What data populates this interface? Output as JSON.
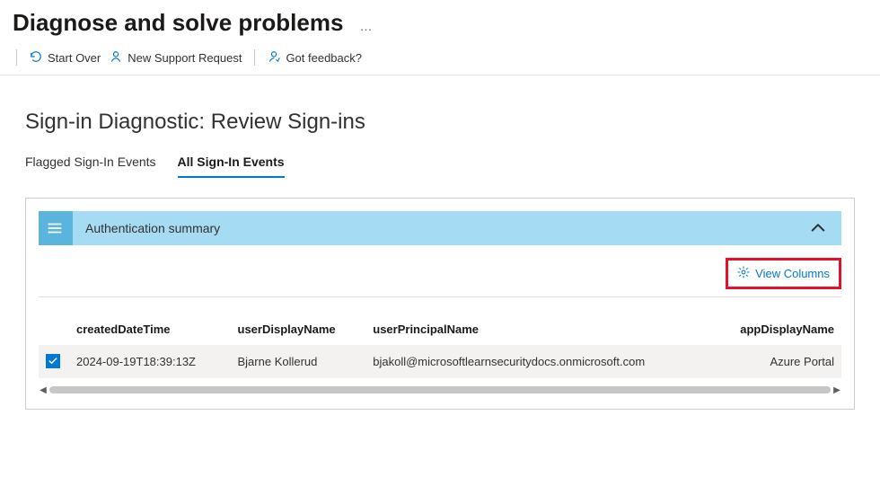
{
  "header": {
    "title": "Diagnose and solve problems",
    "more": "…"
  },
  "toolbar": {
    "startOver": "Start Over",
    "newSupportRequest": "New Support Request",
    "gotFeedback": "Got feedback?"
  },
  "subtitle": "Sign-in Diagnostic: Review Sign-ins",
  "tabs": {
    "flagged": "Flagged Sign-In Events",
    "all": "All Sign-In Events"
  },
  "panel": {
    "authSummaryTitle": "Authentication summary",
    "viewColumns": "View Columns"
  },
  "table": {
    "columns": {
      "createdDateTime": "createdDateTime",
      "userDisplayName": "userDisplayName",
      "userPrincipalName": "userPrincipalName",
      "appDisplayName": "appDisplayName"
    },
    "rows": [
      {
        "checked": true,
        "createdDateTime": "2024-09-19T18:39:13Z",
        "userDisplayName": "Bjarne Kollerud",
        "userPrincipalName": "bjakoll@microsoftlearnsecuritydocs.onmicrosoft.com",
        "appDisplayName": "Azure Portal"
      }
    ]
  }
}
